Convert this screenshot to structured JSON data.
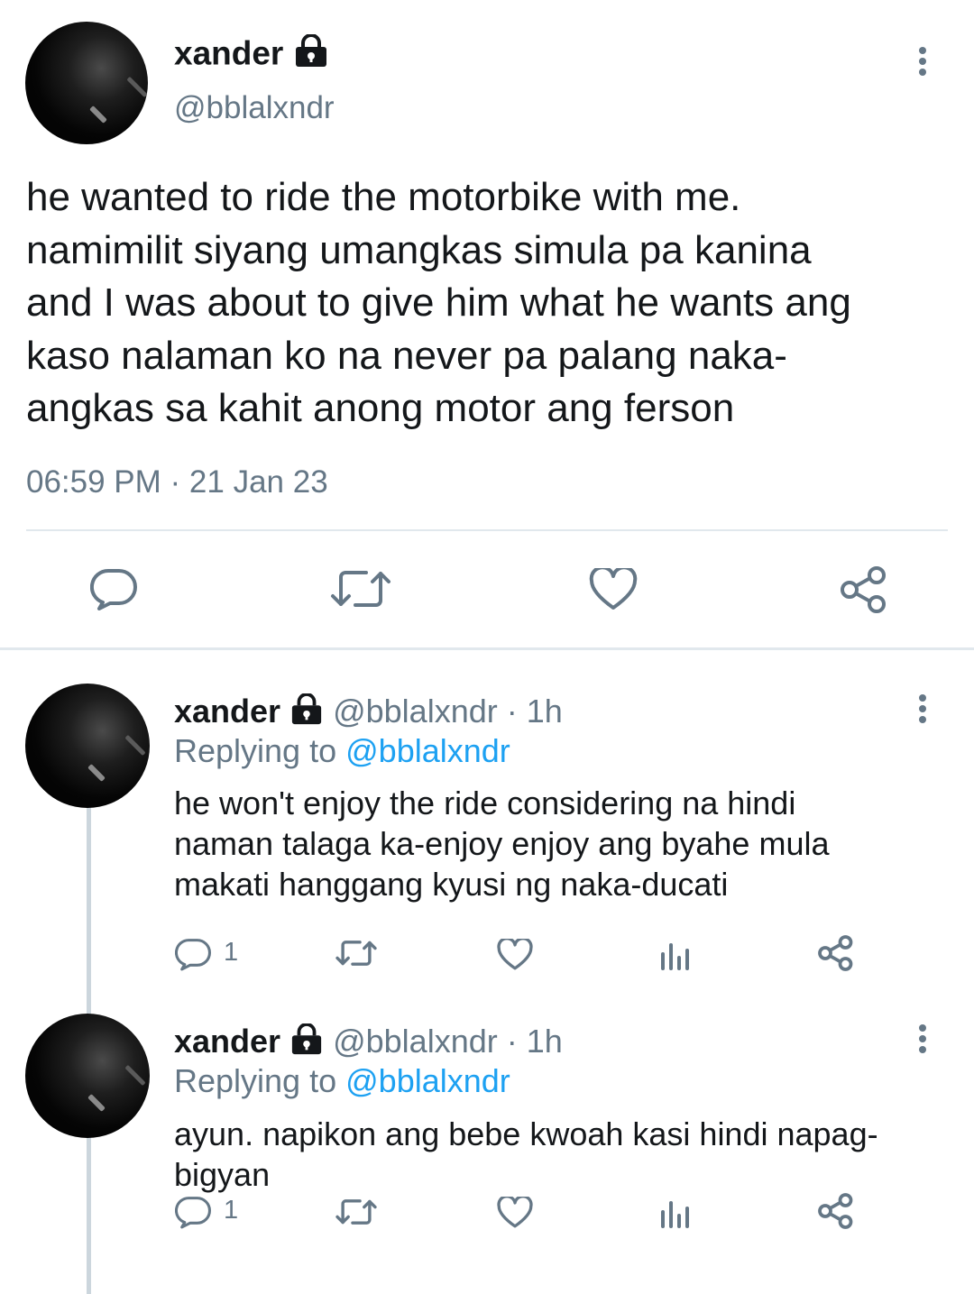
{
  "main_tweet": {
    "display_name": "xander",
    "handle": "@bblalxndr",
    "text_lines": [
      "he wanted to ride the motorbike with me.",
      "namimilit siyang umangkas simula pa kanina",
      "and I was about to give him what he wants ang",
      "kaso nalaman ko na never pa palang naka-",
      "angkas sa kahit anong motor ang ferson"
    ],
    "timestamp": "06:59 PM · 21 Jan 23",
    "actions": {
      "reply_icon": "reply-icon",
      "retweet_icon": "retweet-icon",
      "like_icon": "heart-icon",
      "share_icon": "share-icon"
    }
  },
  "replies": [
    {
      "display_name": "xander",
      "handle_time": "@bblalxndr · 1h",
      "replying_prefix": "Replying to",
      "replying_handle": "@bblalxndr",
      "text_lines": [
        "he won't enjoy the ride considering na hindi",
        "naman talaga ka-enjoy enjoy ang byahe mula",
        "makati hanggang kyusi ng naka-ducati"
      ],
      "reply_count": "1"
    },
    {
      "display_name": "xander",
      "handle_time": "@bblalxndr · 1h",
      "replying_prefix": "Replying to",
      "replying_handle": "@bblalxndr",
      "text_lines": [
        "ayun. napikon ang bebe kwoah kasi hindi napag-",
        "bigyan"
      ],
      "reply_count": "1"
    }
  ],
  "colors": {
    "link": "#1da1f2",
    "secondary": "#657786",
    "divider": "#e1e8ed",
    "text": "#14171a"
  }
}
